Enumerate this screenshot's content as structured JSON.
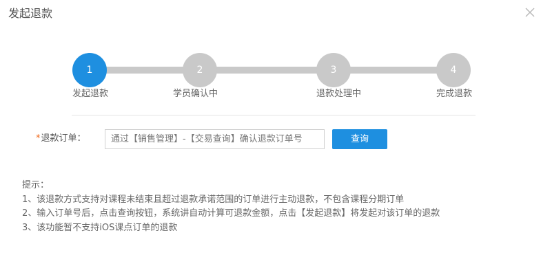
{
  "dialog": {
    "title": "发起退款",
    "close_icon": "close-icon"
  },
  "stepper": {
    "steps": [
      {
        "number": "1",
        "label": "发起退款",
        "active": true
      },
      {
        "number": "2",
        "label": "学员确认中",
        "active": false
      },
      {
        "number": "3",
        "label": "退款处理中",
        "active": false
      },
      {
        "number": "4",
        "label": "完成退款",
        "active": false
      }
    ],
    "active_color": "#1e8fe0",
    "inactive_color": "#c9c9c9"
  },
  "form": {
    "required_mark": "*",
    "order_label": "退款订单：",
    "order_value": "通过【销售管理】-【交易查询】确认退款订单号",
    "query_button": "查询"
  },
  "tips": {
    "heading": "提示：",
    "items": [
      "1、该退款方式支持对课程未结束且超过退款承诺范围的订单进行主动退款，不包含课程分期订单",
      "2、输入订单号后，点击查询按钮，系统讲自动计算可退款金额，点击【发起退款】将发起对该订单的退款",
      "3、该功能暂不支持iOS课点订单的退款"
    ]
  }
}
